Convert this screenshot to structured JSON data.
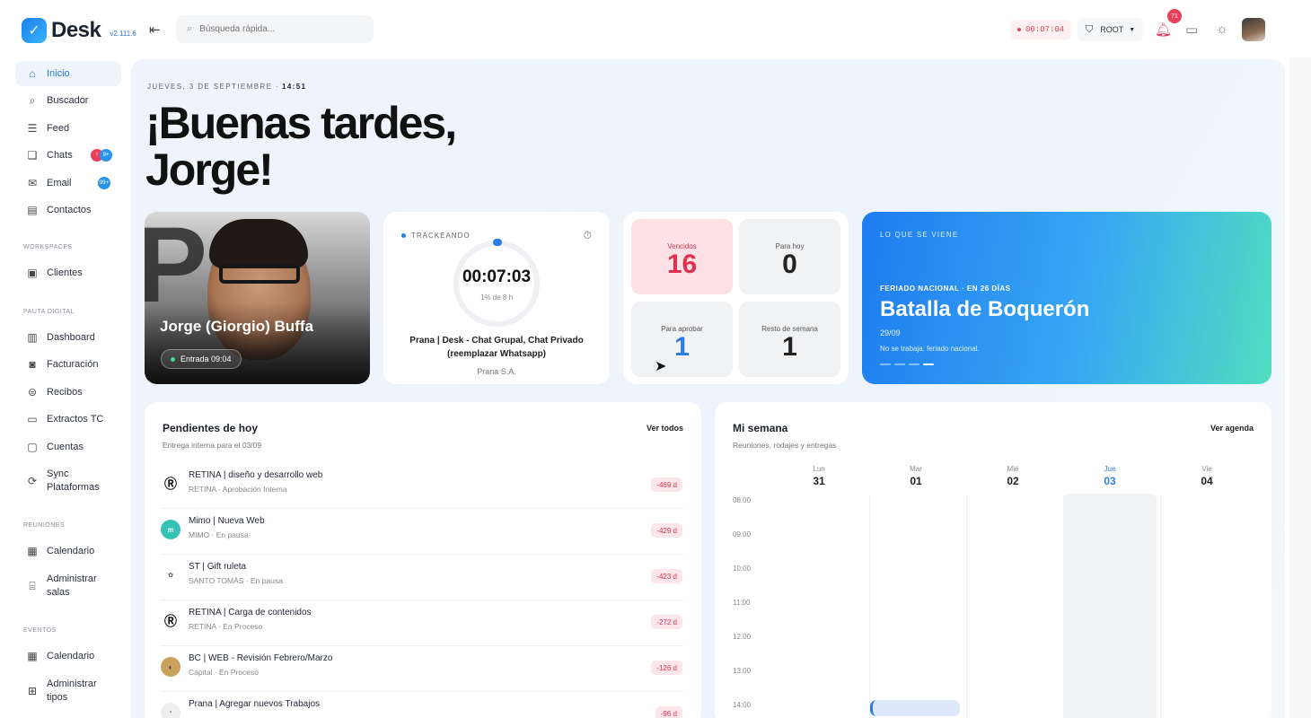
{
  "app": {
    "name": "Desk",
    "version": "v2.111.6"
  },
  "search": {
    "placeholder": "Búsqueda rápida..."
  },
  "topbar": {
    "timer": "00:07:04",
    "role": "ROOT",
    "notifications": "71"
  },
  "sidebar": {
    "items": [
      {
        "label": "Inicio",
        "icon": "home-icon",
        "active": true
      },
      {
        "label": "Buscador",
        "icon": "search-icon"
      },
      {
        "label": "Feed",
        "icon": "feed-icon"
      },
      {
        "label": "Chats",
        "icon": "chat-icon",
        "badges": [
          "!",
          "9+"
        ]
      },
      {
        "label": "Email",
        "icon": "mail-icon",
        "badges": [
          "99+"
        ]
      },
      {
        "label": "Contactos",
        "icon": "contacts-icon"
      }
    ],
    "sections": {
      "workspaces": "WORKSPACES",
      "pauta": "PAUTA DIGITAL",
      "reuniones": "REUNIONES",
      "eventos": "EVENTOS"
    },
    "workspaces": [
      {
        "label": "Clientes",
        "icon": "briefcase-icon"
      }
    ],
    "pauta": [
      {
        "label": "Dashboard",
        "icon": "chart-icon"
      },
      {
        "label": "Facturación",
        "icon": "invoice-icon"
      },
      {
        "label": "Recibos",
        "icon": "receipt-icon"
      },
      {
        "label": "Extractos TC",
        "icon": "card-icon"
      },
      {
        "label": "Cuentas",
        "icon": "account-icon"
      },
      {
        "label": "Sync Plataformas",
        "icon": "sync-icon"
      }
    ],
    "reuniones": [
      {
        "label": "Calendario",
        "icon": "calendar-icon"
      },
      {
        "label": "Administrar salas",
        "icon": "rooms-icon"
      }
    ],
    "eventos": [
      {
        "label": "Calendario",
        "icon": "calendar-icon"
      },
      {
        "label": "Administrar tipos",
        "icon": "grid-icon"
      }
    ]
  },
  "header": {
    "date": "JUEVES, 3 DE SEPTIEMBRE ·",
    "time": "14:51",
    "greeting_line1": "¡Buenas tardes,",
    "greeting_line2": "Jorge!"
  },
  "profile": {
    "name": "Jorge (Giorgio) Buffa",
    "entry": "Entrada 09:04"
  },
  "tracking": {
    "label": "TRACKEANDO",
    "time": "00:07:03",
    "percent": "1% de 8 h",
    "progress_fraction": 0.01,
    "task": "Prana | Desk - Chat Grupal, Chat Privado (reemplazar Whatsapp)",
    "client": "Prana S.A."
  },
  "stats": [
    {
      "label": "Vencidos",
      "value": "16"
    },
    {
      "label": "Para hoy",
      "value": "0"
    },
    {
      "label": "Para aprobar",
      "value": "1"
    },
    {
      "label": "Resto de semana",
      "value": "1"
    }
  ],
  "upcoming": {
    "label": "LO QUE SE VIENE",
    "subtitle": "FERIADO NACIONAL · EN 26 DÍAS",
    "title": "Batalla de Boquerón",
    "date": "29/09",
    "note": "No se trabaja: feriado nacional."
  },
  "pending": {
    "title": "Pendientes de hoy",
    "subtitle": "Entrega interna para el 03/09",
    "link": "Ver todos",
    "rows": [
      {
        "title": "RETINA | diseño y desarrollo web",
        "sub": "RETINA · Aprobación Interna",
        "badge": "-469 d",
        "logo": "retina-logo"
      },
      {
        "title": "Mimo | Nueva Web",
        "sub": "MIMO · En pausa",
        "badge": "-429 d",
        "logo": "mimo-logo"
      },
      {
        "title": "ST | Gift ruleta",
        "sub": "SANTO TOMÁS · En pausa",
        "badge": "-423 d",
        "logo": "santotomas-logo"
      },
      {
        "title": "RETINA | Carga de contenidos",
        "sub": "RETINA · En Proceso",
        "badge": "-272 d",
        "logo": "retina-logo"
      },
      {
        "title": "BC | WEB - Revisión Febrero/Marzo",
        "sub": "Capital · En Proceso",
        "badge": "-126 d",
        "logo": "capital-logo"
      },
      {
        "title": "Prana | Agregar nuevos Trabajos",
        "sub": "",
        "badge": "-96 d",
        "logo": "prana-logo"
      }
    ]
  },
  "week": {
    "title": "Mi semana",
    "subtitle": "Reuniones, rodajes y entregas",
    "link": "Ver agenda",
    "days": [
      {
        "name": "Lun",
        "num": "31"
      },
      {
        "name": "Mar",
        "num": "01"
      },
      {
        "name": "Mié",
        "num": "02"
      },
      {
        "name": "Jue",
        "num": "03",
        "today": true
      },
      {
        "name": "Vie",
        "num": "04"
      }
    ],
    "hours": [
      "08:00",
      "09:00",
      "10:00",
      "11:00",
      "12:00",
      "13:00",
      "14:00"
    ]
  }
}
